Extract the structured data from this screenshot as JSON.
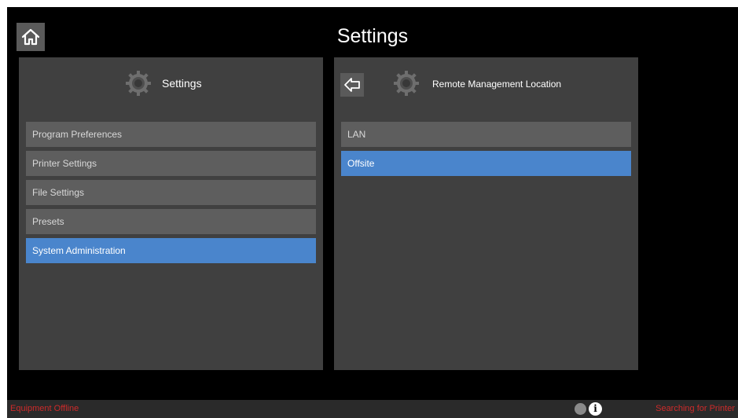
{
  "header": {
    "title": "Settings",
    "home_icon": "home-icon"
  },
  "left_panel": {
    "title": "Settings",
    "icon": "gear-icon",
    "items": [
      {
        "label": "Program Preferences",
        "selected": false
      },
      {
        "label": "Printer Settings",
        "selected": false
      },
      {
        "label": "File Settings",
        "selected": false
      },
      {
        "label": "Presets",
        "selected": false
      },
      {
        "label": "System Administration",
        "selected": true
      }
    ]
  },
  "right_panel": {
    "title": "Remote Management Location",
    "icon": "gear-icon",
    "back_icon": "back-arrow-icon",
    "items": [
      {
        "label": "LAN",
        "selected": false
      },
      {
        "label": "Offsite",
        "selected": true
      }
    ]
  },
  "status_bar": {
    "left_text": "Equipment Offline",
    "right_text": "Searching for Printer",
    "info_icon": "info-icon"
  },
  "colors": {
    "background": "#000000",
    "panel": "#404040",
    "menu_item": "#5e5e5e",
    "selected": "#4a85cc",
    "status_text": "#cc2a2a"
  }
}
